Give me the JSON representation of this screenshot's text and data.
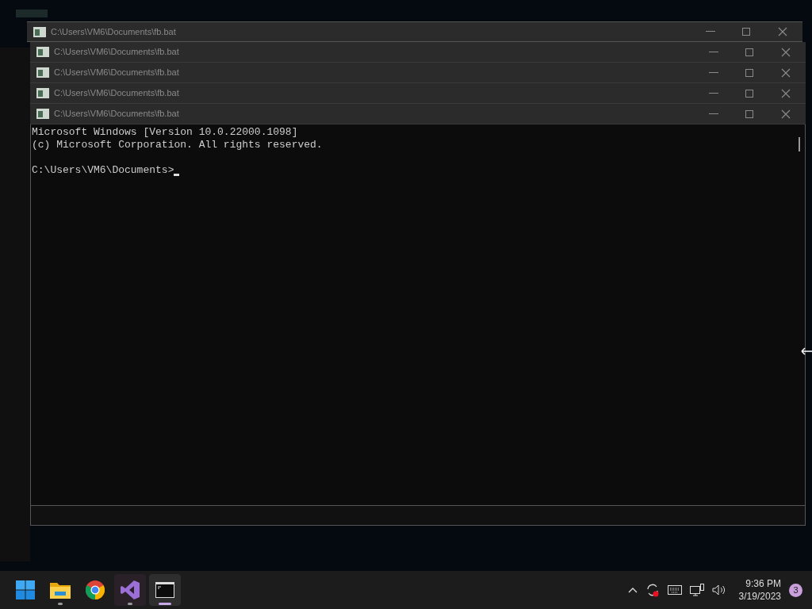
{
  "windows": [
    {
      "title": "C:\\Users\\VM6\\Documents\\fb.bat"
    },
    {
      "title": "C:\\Users\\VM6\\Documents\\fb.bat"
    },
    {
      "title": "C:\\Users\\VM6\\Documents\\fb.bat"
    },
    {
      "title": "C:\\Users\\VM6\\Documents\\fb.bat"
    },
    {
      "title": "C:\\Users\\VM6\\Documents\\fb.bat"
    }
  ],
  "console": {
    "lines": [
      "Microsoft Windows [Version 10.0.22000.1098]",
      "(c) Microsoft Corporation. All rights reserved."
    ],
    "prompt": "C:\\Users\\VM6\\Documents>"
  },
  "taskbar": {
    "apps": [
      {
        "kind": "start",
        "running": false,
        "selected": false
      },
      {
        "kind": "explorer",
        "running": true,
        "selected": false
      },
      {
        "kind": "chrome",
        "running": false,
        "selected": false
      },
      {
        "kind": "studio",
        "running": true,
        "selected": false
      },
      {
        "kind": "terminal",
        "running": true,
        "selected": true
      }
    ],
    "time": "9:36 PM",
    "date": "3/19/2023",
    "notifications": "3"
  }
}
